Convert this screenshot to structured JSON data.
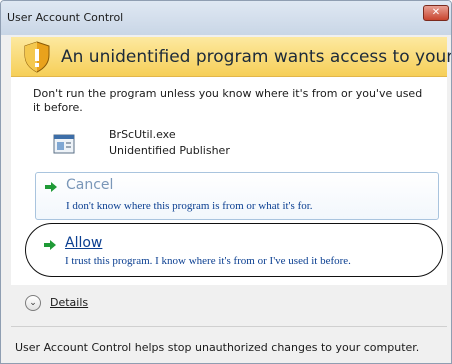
{
  "window": {
    "title": "User Account Control",
    "close_symbol": "✕"
  },
  "banner": {
    "icon": "shield-warning-icon",
    "heading": "An unidentified program wants access to your computer"
  },
  "content": {
    "warning": "Don't run the program unless you know where it's from or you've used it before.",
    "program_icon": "program-icon",
    "program_name": "BrScUtil.exe",
    "publisher": "Unidentified Publisher"
  },
  "options": {
    "cancel": {
      "title": "Cancel",
      "description": "I don't know where this program is from or what it's for.",
      "icon": "green-arrow-icon"
    },
    "allow": {
      "title": "Allow",
      "description": "I trust this program. I know where it's from or I've used it before.",
      "icon": "green-arrow-icon"
    }
  },
  "details": {
    "label": "Details",
    "icon": "chevron-down-icon"
  },
  "footer": {
    "text": "User Account Control helps stop unauthorized changes to your computer."
  },
  "colors": {
    "banner_bg": "#f6cf58",
    "link_blue": "#0b3f91",
    "cancel_muted": "#7a97b8",
    "arrow_green": "#1f9a36"
  }
}
